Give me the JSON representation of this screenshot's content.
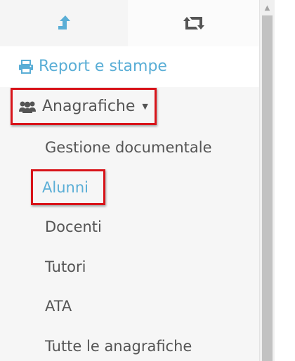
{
  "tabs": [
    {
      "icon": "upload-arrow-icon",
      "active": true
    },
    {
      "icon": "retweet-icon",
      "active": false
    }
  ],
  "menu": {
    "report": {
      "label": "Report e stampe",
      "icon": "print-icon"
    },
    "anagrafiche": {
      "label": "Anagrafiche",
      "icon": "users-icon",
      "caret": "▼"
    }
  },
  "submenu": {
    "items": [
      "Gestione documentale",
      "Alunni",
      "Docenti",
      "Tutori",
      "ATA",
      "Tutte le anagrafiche"
    ],
    "active_index": 1
  },
  "colors": {
    "accent": "#5aaed6",
    "text": "#555555",
    "highlight": "#d8141a"
  },
  "scrollbar": {
    "up_arrow": "▲"
  }
}
